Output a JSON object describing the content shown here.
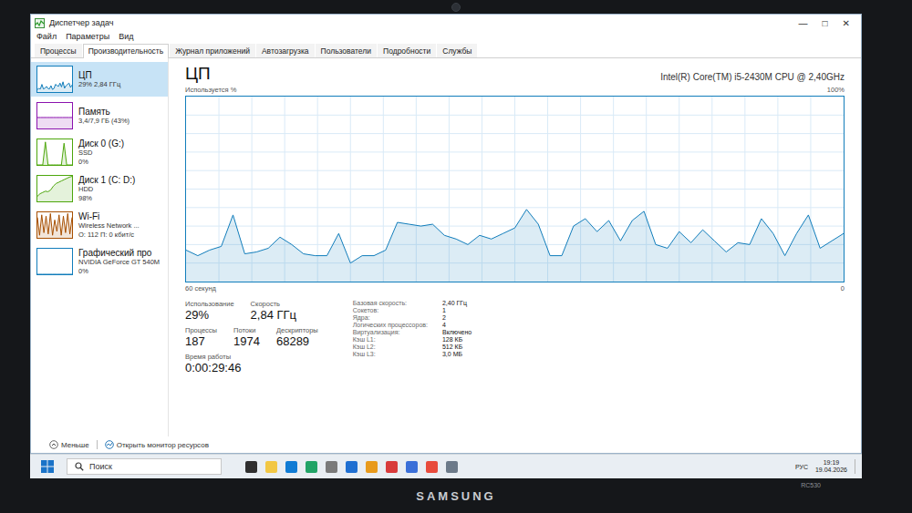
{
  "window": {
    "title": "Диспетчер задач",
    "controls": [
      "—",
      "□",
      "✕"
    ]
  },
  "menu": [
    "Файл",
    "Параметры",
    "Вид"
  ],
  "tabs": [
    {
      "label": "Процессы",
      "selected": false
    },
    {
      "label": "Производительность",
      "selected": true
    },
    {
      "label": "Журнал приложений",
      "selected": false
    },
    {
      "label": "Автозагрузка",
      "selected": false
    },
    {
      "label": "Пользователи",
      "selected": false
    },
    {
      "label": "Подробности",
      "selected": false
    },
    {
      "label": "Службы",
      "selected": false
    }
  ],
  "sidebar": {
    "items": [
      {
        "name": "ЦП",
        "lines": [
          "29% 2,84 ГГц"
        ],
        "selected": true,
        "color": "#117dbb",
        "graph": [
          10,
          14,
          12,
          30,
          12,
          15,
          22,
          14,
          12,
          25,
          10,
          14,
          30,
          26,
          22,
          35,
          20,
          40,
          15,
          25,
          30,
          35,
          18,
          28
        ]
      },
      {
        "name": "Память",
        "lines": [
          "3,4/7,9 ГБ (43%)"
        ],
        "selected": false,
        "color": "#8b12ae",
        "graph": [
          43,
          43,
          43,
          43,
          43,
          43,
          43,
          43,
          43,
          43,
          43,
          43
        ]
      },
      {
        "name": "Диск 0 (G:)",
        "lines": [
          "SSD",
          "0%"
        ],
        "selected": false,
        "color": "#4da60c",
        "graph": [
          0,
          0,
          0,
          90,
          0,
          0,
          0,
          0,
          0,
          0,
          85,
          0,
          0,
          0
        ]
      },
      {
        "name": "Диск 1 (C: D:)",
        "lines": [
          "HDD",
          "98%"
        ],
        "selected": false,
        "color": "#4da60c",
        "graph": [
          20,
          30,
          35,
          40,
          38,
          45,
          60,
          70,
          75,
          80,
          85,
          90,
          95,
          98
        ]
      },
      {
        "name": "Wi-Fi",
        "lines": [
          "Wireless Network ...",
          "О: 112 П: 0 кбит/с"
        ],
        "selected": false,
        "color": "#a74f01",
        "graph": [
          80,
          10,
          90,
          20,
          85,
          15,
          95,
          10,
          70,
          25,
          90,
          10,
          85,
          20,
          95,
          15,
          80
        ]
      },
      {
        "name": "Графический про",
        "lines": [
          "NVIDIA GeForce GT 540M",
          "0%"
        ],
        "selected": false,
        "color": "#117dbb",
        "graph": [
          0,
          0,
          0,
          0,
          0,
          0,
          0,
          0
        ]
      }
    ]
  },
  "main": {
    "title": "ЦП",
    "cpu_name": "Intel(R) Core(TM) i5-2430M CPU @ 2,40GHz"
  },
  "chart": {
    "y_label": "Используется %",
    "y_max_label": "100%",
    "x_label": "60 секунд",
    "x_min_label": "0",
    "series": [
      {
        "values": [
          17,
          14,
          17,
          19,
          36,
          15,
          16,
          18,
          24,
          20,
          15,
          14,
          14,
          26,
          10,
          14,
          14,
          17,
          32,
          31,
          30,
          31,
          25,
          23,
          20,
          25,
          23,
          26,
          29,
          39,
          31,
          14,
          14,
          30,
          34,
          27,
          33,
          22,
          33,
          38,
          20,
          18,
          27,
          21,
          28,
          22,
          16,
          21,
          20,
          34,
          26,
          14,
          26,
          36,
          18,
          22,
          26
        ]
      }
    ]
  },
  "stats": {
    "primary": [
      {
        "label": "Использование",
        "value": "29%"
      },
      {
        "label": "Скорость",
        "value": "2,84 ГГц"
      }
    ],
    "counts": [
      {
        "label": "Процессы",
        "value": "187"
      },
      {
        "label": "Потоки",
        "value": "1974"
      },
      {
        "label": "Дескрипторы",
        "value": "68289"
      }
    ],
    "uptime": {
      "label": "Время работы",
      "value": "0:00:29:46"
    },
    "details": [
      {
        "label": "Базовая скорость:",
        "value": "2,40 ГГц"
      },
      {
        "label": "Сокетов:",
        "value": "1"
      },
      {
        "label": "Ядра:",
        "value": "2"
      },
      {
        "label": "Логических процессоров:",
        "value": "4"
      },
      {
        "label": "Виртуализация:",
        "value": "Включено"
      },
      {
        "label": "Кэш L1:",
        "value": "128 КБ"
      },
      {
        "label": "Кэш L2:",
        "value": "512 КБ"
      },
      {
        "label": "Кэш L3:",
        "value": "3,0 МБ"
      }
    ]
  },
  "footer": {
    "less": "Меньше",
    "monitor": "Открыть монитор ресурсов"
  },
  "taskbar": {
    "search": "Поиск",
    "lang": "РУС",
    "time": "19:19",
    "date": "19.04.2026"
  },
  "bezel": {
    "brand": "SAMSUNG",
    "model": "RC530"
  }
}
